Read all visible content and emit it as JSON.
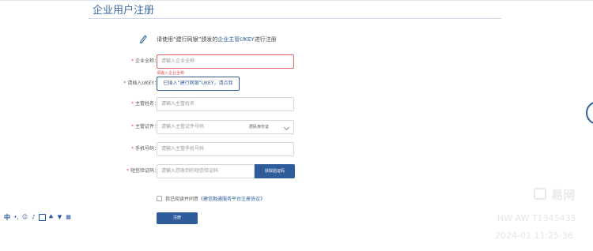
{
  "page": {
    "title": "企业用户注册",
    "notice_prefix": "请使用“建行网银”颁发的",
    "notice_highlight": "企业主管UKEY",
    "notice_suffix": "进行注册"
  },
  "form": {
    "required_mark": "*",
    "company_name": {
      "label": "企业全称：",
      "placeholder": "请输入企业全称",
      "error": "请输入企业全称"
    },
    "ukey": {
      "label": "请插入UKEY：",
      "button": "已插入“建行网银”UKEY，请点我"
    },
    "manager_name": {
      "label": "主管姓名：",
      "placeholder": "请输入主管姓名"
    },
    "manager_id": {
      "label": "主管证件：",
      "placeholder": "请输入主管证件号码",
      "select_value": "居民身份证"
    },
    "phone": {
      "label": "手机号码：",
      "placeholder": "请输入主管手机号码"
    },
    "sms": {
      "label": "短信验证码：",
      "placeholder": "请输入您收到的短信验证码",
      "button": "获取验证码"
    },
    "agreement": {
      "prefix": "我已阅读并同意",
      "link": "《建信融通服务平台注册协议》"
    },
    "submit": "注册"
  },
  "ime_toolbar": {
    "mode": "中",
    "icons": [
      "punctuation-icon",
      "emoji-icon",
      "microphone-icon",
      "keyboard-icon",
      "skin-icon",
      "shirt-icon",
      "grid-icon"
    ]
  },
  "watermark": {
    "brand": "易网",
    "line1": "HW AW T1345435",
    "line2": "2024-01 11:25:36"
  }
}
